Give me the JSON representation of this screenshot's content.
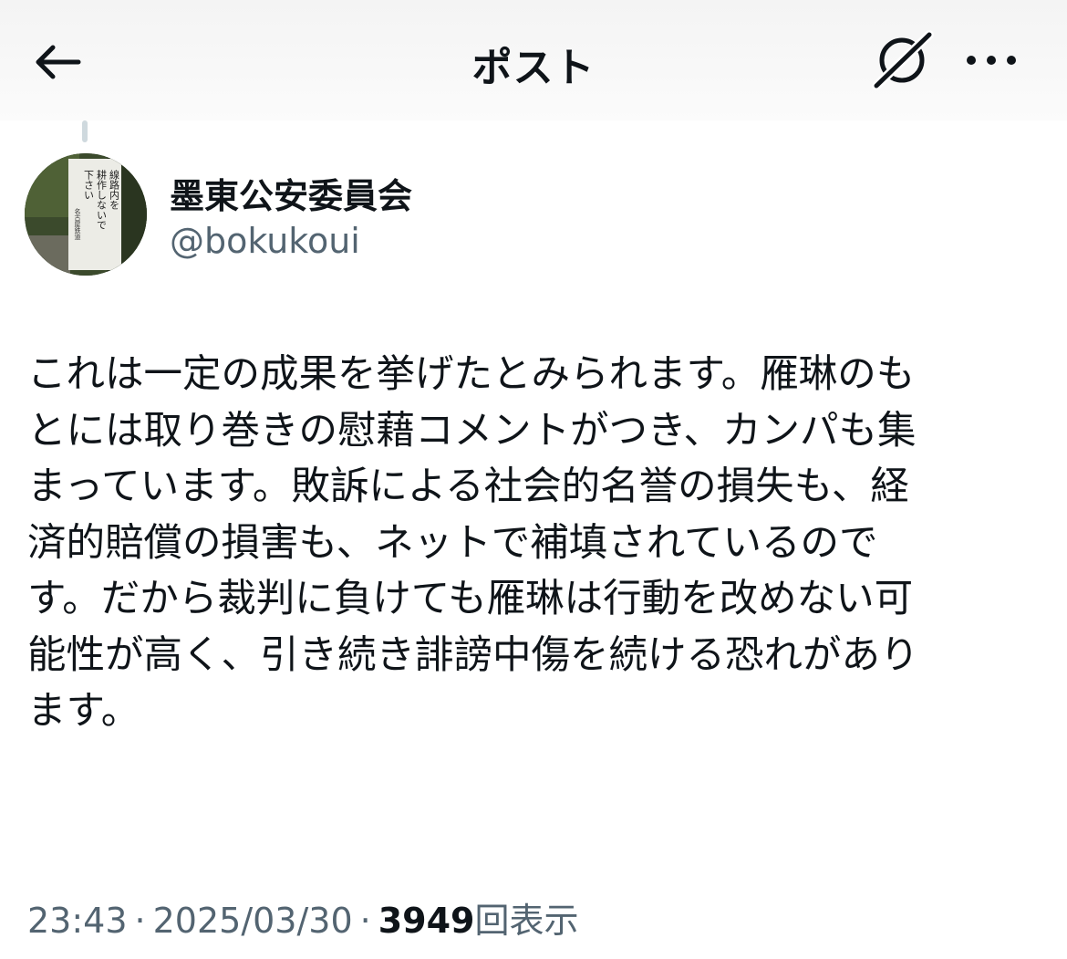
{
  "header": {
    "title": "ポスト",
    "back_icon": "arrow-left-icon",
    "grok_icon": "grok-icon",
    "more_icon": "more-horizontal-icon"
  },
  "author": {
    "name": "墨東公安委員会",
    "handle": "@bokukoui",
    "avatar_sign_lines": [
      "線路内を",
      "耕作しないで",
      "下さい"
    ],
    "avatar_sign_footer": "名古屋鉄道"
  },
  "post": {
    "lines": [
      "これは一定の成果を挙げたとみられます。雁琳のも",
      "とには取り巻きの慰藉コメントがつき、カンパも集",
      "まっています。敗訴による社会的名誉の損失も、経",
      "済的賠償の損害も、ネットで補填されているので",
      "す。だから裁判に負けても雁琳は行動を改めない可",
      "能性が高く、引き続き誹謗中傷を続ける恐れがあり",
      "ます。"
    ]
  },
  "meta": {
    "time": "23:43",
    "separator": "·",
    "date": "2025/03/30",
    "views": "3949",
    "views_label": "回表示"
  },
  "colors": {
    "text": "#0f1419",
    "secondary": "#536471",
    "header_bg": "#f4f4f4",
    "thread_line": "#cfd9de"
  }
}
